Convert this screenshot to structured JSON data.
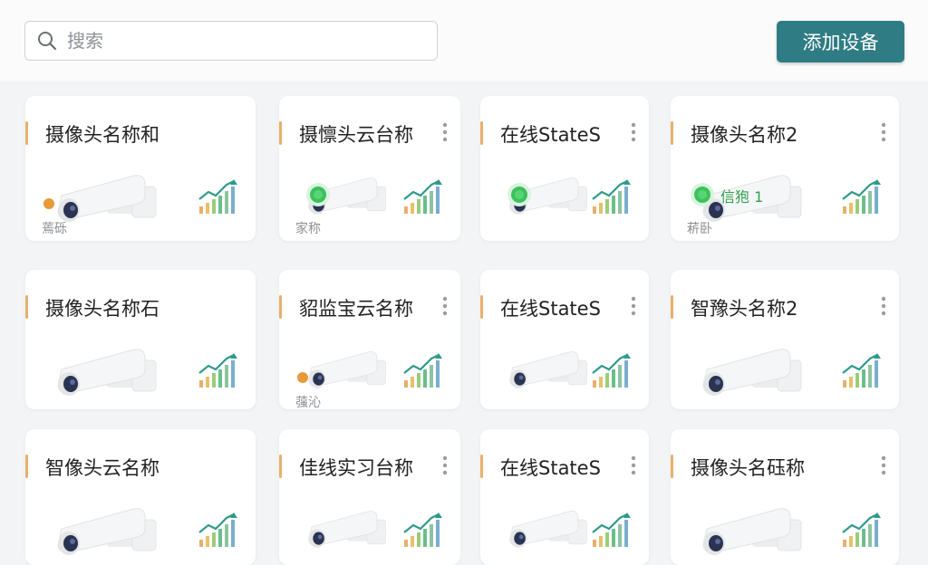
{
  "search": {
    "placeholder": "搜索"
  },
  "toolbar": {
    "add_label": "添加设备"
  },
  "colors": {
    "accent": "#2f7c84",
    "bar": "#e8b06a",
    "online": "#3cc25a",
    "offline": "#e89a3a"
  },
  "cards": [
    {
      "title": "摄像头名称和",
      "sub": "蔫砾",
      "status": "offline",
      "status_text": ""
    },
    {
      "title": "摄懔头云台称",
      "sub": "家称",
      "status": "online",
      "status_text": ""
    },
    {
      "title": "在线StateS",
      "sub": "",
      "status": "online",
      "status_text": ""
    },
    {
      "title": "摄像头名称2",
      "sub": "菥卧",
      "status": "online",
      "status_text": "信狍 1"
    },
    {
      "title": "摄像头名称石",
      "sub": "",
      "status": "none",
      "status_text": ""
    },
    {
      "title": "貂监宝云名称",
      "sub": "蔃沁",
      "status": "offline",
      "status_text": ""
    },
    {
      "title": "在线StateS",
      "sub": "",
      "status": "none",
      "status_text": ""
    },
    {
      "title": "智豫头名称2",
      "sub": "",
      "status": "none",
      "status_text": ""
    },
    {
      "title": "智像头云名称",
      "sub": "",
      "status": "none",
      "status_text": ""
    },
    {
      "title": "佳线实习台称",
      "sub": "",
      "status": "none",
      "status_text": ""
    },
    {
      "title": "在线StateS",
      "sub": "",
      "status": "none",
      "status_text": ""
    },
    {
      "title": "摄像头名砡称",
      "sub": "",
      "status": "none",
      "status_text": ""
    }
  ]
}
